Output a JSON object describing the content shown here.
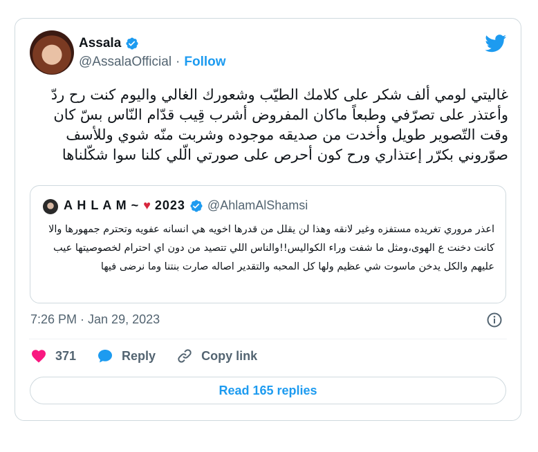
{
  "author": {
    "name": "Assala",
    "handle": "@AssalaOfficial",
    "follow_label": "Follow"
  },
  "tweet": {
    "text": "غاليتي لومي ألف شكر على كلامك الطيّب وشعورك الغالي واليوم كنت رح ردّ وأعتذر على تصرّفي وطبعاً ماكان المفروض أشرب قِيب قدّام النّاس بسّ كان وقت التّصوير طويل وأخدت من صديقه موجوده وشربت منّه شوي وللأسف صوّروني بكرّر إعتذاري ورح كون أحرص على صورتي الّلي كلنا سوا شكّلناها"
  },
  "quote": {
    "name": "A H L A M ~",
    "heart": "♥",
    "year": "2023",
    "handle": "@AhlamAlShamsi",
    "text": "اعذر مروري تغريده مستفزه وغير لانقه وهذا لن يقلل من قدرها اخويه هي انسانه عفويه وتحترم جمهورها والا كانت دخنت ع الهوى،ومثل ما شفت وراء الكواليس!!والناس اللي تتصيد من دون اي احترام لخصوصيتها عيب عليهم والكل يدخن ماسوت شي عظيم ولها كل المحبه والتقدير اصاله صارت بنتنا وما نرضى فيها"
  },
  "meta": {
    "timestamp": "7:26 PM · Jan 29, 2023"
  },
  "actions": {
    "likes": "371",
    "reply_label": "Reply",
    "copy_link_label": "Copy link"
  },
  "read_replies_label": "Read 165 replies",
  "colors": {
    "accent": "#1d9bf0",
    "like": "#f91880",
    "muted": "#536471",
    "border": "#cfd9de"
  },
  "icons": [
    "verified-badge-icon",
    "twitter-bird-icon",
    "info-icon",
    "heart-icon",
    "reply-bubble-icon",
    "link-icon"
  ]
}
